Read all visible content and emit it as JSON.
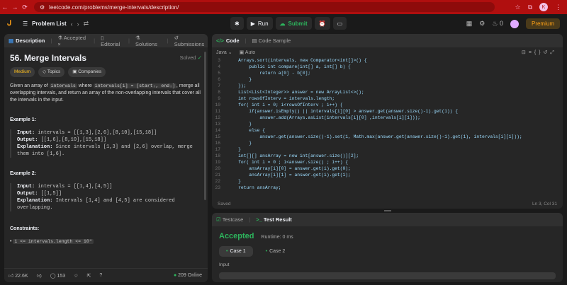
{
  "browser": {
    "url": "leetcode.com/problems/merge-intervals/description/",
    "profile_initial": "K"
  },
  "topbar": {
    "problem_list": "Problem List",
    "run": "Run",
    "submit": "Submit",
    "streak": "0",
    "premium": "Premium"
  },
  "left_tabs": [
    "Description",
    "Accepted",
    "Editorial",
    "Solutions",
    "Submissions"
  ],
  "problem": {
    "title": "56. Merge Intervals",
    "status": "Solved",
    "difficulty": "Medium",
    "topics": "Topics",
    "companies": "Companies",
    "desc_1": "Given an array of",
    "desc_code1": "intervals",
    "desc_2": "where",
    "desc_code2": "intervals[i] = [startᵢ, endᵢ]",
    "desc_3": ", merge all overlapping intervals, and return an array of the non-overlapping intervals that cover all the intervals in the input.",
    "examples": [
      {
        "title": "Example 1:",
        "input": "intervals = [[1,3],[2,6],[8,10],[15,18]]",
        "output": "[[1,6],[8,10],[15,18]]",
        "explanation": "Since intervals [1,3] and [2,6] overlap, merge them into [1,6]."
      },
      {
        "title": "Example 2:",
        "input": "intervals = [[1,4],[4,5]]",
        "output": "[[1,5]]",
        "explanation": "Intervals [1,4] and [4,5] are considered overlapping."
      }
    ],
    "constraints_title": "Constraints:",
    "constraint_1": "1 <= intervals.length <= 10⁴",
    "labels": {
      "input": "Input:",
      "output": "Output:",
      "explanation": "Explanation:"
    }
  },
  "left_bottom": {
    "likes": "22.6K",
    "comments": "153",
    "online": "209 Online"
  },
  "code_panel": {
    "tabs": [
      "Code",
      "Code Sample"
    ],
    "language": "Java",
    "mode": "Auto",
    "lines": [
      {
        "n": "3",
        "t": "    Arrays.sort(intervals, new Comparator<int[]>() {"
      },
      {
        "n": "4",
        "t": "        public int compare(int[] a, int[] b) {"
      },
      {
        "n": "5",
        "t": "            return a[0] - b[0];"
      },
      {
        "n": "6",
        "t": "        }"
      },
      {
        "n": "7",
        "t": "    });"
      },
      {
        "n": "8",
        "t": "    List<List<Integer>> answer = new ArrayList<>();"
      },
      {
        "n": "9",
        "t": "    int rowsOfInterv = intervals.length;"
      },
      {
        "n": "10",
        "t": "    for( int i = 0; i<rowsOfInterv ; i++) {"
      },
      {
        "n": "11",
        "t": "        if(answer.isEmpty() || intervals[i][0] > answer.get(answer.size()-1).get(1)) {"
      },
      {
        "n": "12",
        "t": "            answer.add(Arrays.asList(intervals[i][0] ,intervals[i][1]));"
      },
      {
        "n": "13",
        "t": "        }"
      },
      {
        "n": "14",
        "t": "        else {"
      },
      {
        "n": "15",
        "t": "            answer.get(answer.size()-1).set(1, Math.max(answer.get(answer.size()-1).get(1), intervals[i][1]));"
      },
      {
        "n": "16",
        "t": "        }"
      },
      {
        "n": "17",
        "t": "    }"
      },
      {
        "n": "18",
        "t": "    int[][] ansArray = new int[answer.size()][2];"
      },
      {
        "n": "19",
        "t": "    for( int i = 0 ; i<answer.size() ; i++) {"
      },
      {
        "n": "20",
        "t": "        ansArray[i][0] = answer.get(i).get(0);"
      },
      {
        "n": "21",
        "t": "        ansArray[i][1] = answer.get(i).get(1);"
      },
      {
        "n": "22",
        "t": "    }"
      },
      {
        "n": "23",
        "t": "    return ansArray;"
      }
    ],
    "saved": "Saved",
    "cursor": "Ln 3, Col 31"
  },
  "test_panel": {
    "tabs": [
      "Testcase",
      "Test Result"
    ],
    "result": "Accepted",
    "runtime": "Runtime: 0 ms",
    "cases": [
      "Case 1",
      "Case 2"
    ],
    "input_label": "Input"
  }
}
